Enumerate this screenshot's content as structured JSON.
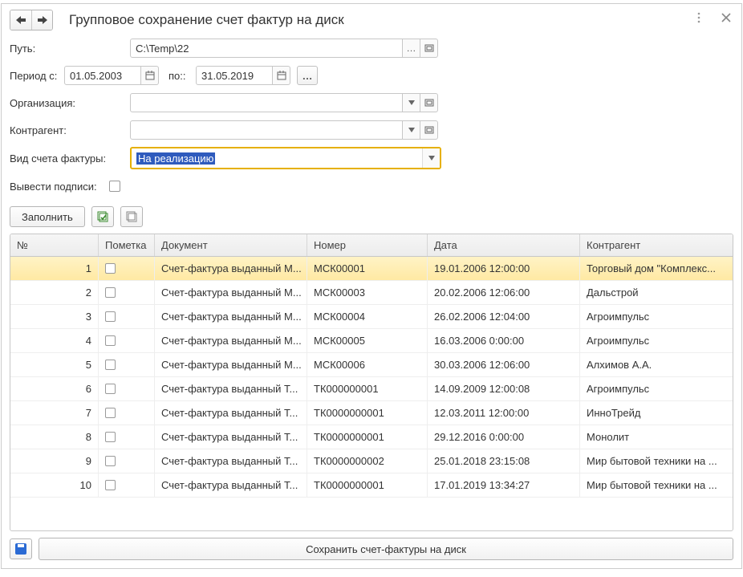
{
  "title": "Групповое сохранение счет фактур на диск",
  "labels": {
    "path": "Путь:",
    "period_from": "Период с:",
    "period_to": "по::",
    "org": "Организация:",
    "counterparty": "Контрагент:",
    "invoice_type": "Вид счета фактуры:",
    "signatures": "Вывести подписи:"
  },
  "values": {
    "path": "C:\\Temp\\22",
    "period_from": "01.05.2003",
    "period_to": "31.05.2019",
    "org": "",
    "counterparty": "",
    "invoice_type": "На реализацию"
  },
  "buttons": {
    "fill": "Заполнить",
    "save": "Сохранить счет-фактуры на диск"
  },
  "table": {
    "headers": {
      "no": "№",
      "mark": "Пометка",
      "doc": "Документ",
      "num": "Номер",
      "date": "Дата",
      "contr": "Контрагент"
    },
    "rows": [
      {
        "no": "1",
        "doc": "Счет-фактура выданный М...",
        "num": "МСК00001",
        "date": "19.01.2006 12:00:00",
        "contr": "Торговый дом \"Комплекс...",
        "selected": true
      },
      {
        "no": "2",
        "doc": "Счет-фактура выданный М...",
        "num": "МСК00003",
        "date": "20.02.2006 12:06:00",
        "contr": "Дальстрой"
      },
      {
        "no": "3",
        "doc": "Счет-фактура выданный М...",
        "num": "МСК00004",
        "date": "26.02.2006 12:04:00",
        "contr": "Агроимпульс"
      },
      {
        "no": "4",
        "doc": "Счет-фактура выданный М...",
        "num": "МСК00005",
        "date": "16.03.2006 0:00:00",
        "contr": "Агроимпульс"
      },
      {
        "no": "5",
        "doc": "Счет-фактура выданный М...",
        "num": "МСК00006",
        "date": "30.03.2006 12:06:00",
        "contr": "Алхимов А.А."
      },
      {
        "no": "6",
        "doc": "Счет-фактура выданный Т...",
        "num": "ТК000000001",
        "date": "14.09.2009 12:00:08",
        "contr": "Агроимпульс"
      },
      {
        "no": "7",
        "doc": "Счет-фактура выданный Т...",
        "num": "ТК0000000001",
        "date": "12.03.2011 12:00:00",
        "contr": "ИнноТрейд"
      },
      {
        "no": "8",
        "doc": "Счет-фактура выданный Т...",
        "num": "ТК0000000001",
        "date": "29.12.2016 0:00:00",
        "contr": "Монолит"
      },
      {
        "no": "9",
        "doc": "Счет-фактура выданный Т...",
        "num": "ТК0000000002",
        "date": "25.01.2018 23:15:08",
        "contr": "Мир бытовой техники на ..."
      },
      {
        "no": "10",
        "doc": "Счет-фактура выданный Т...",
        "num": "ТК0000000001",
        "date": "17.01.2019 13:34:27",
        "contr": "Мир бытовой техники на ..."
      }
    ]
  }
}
